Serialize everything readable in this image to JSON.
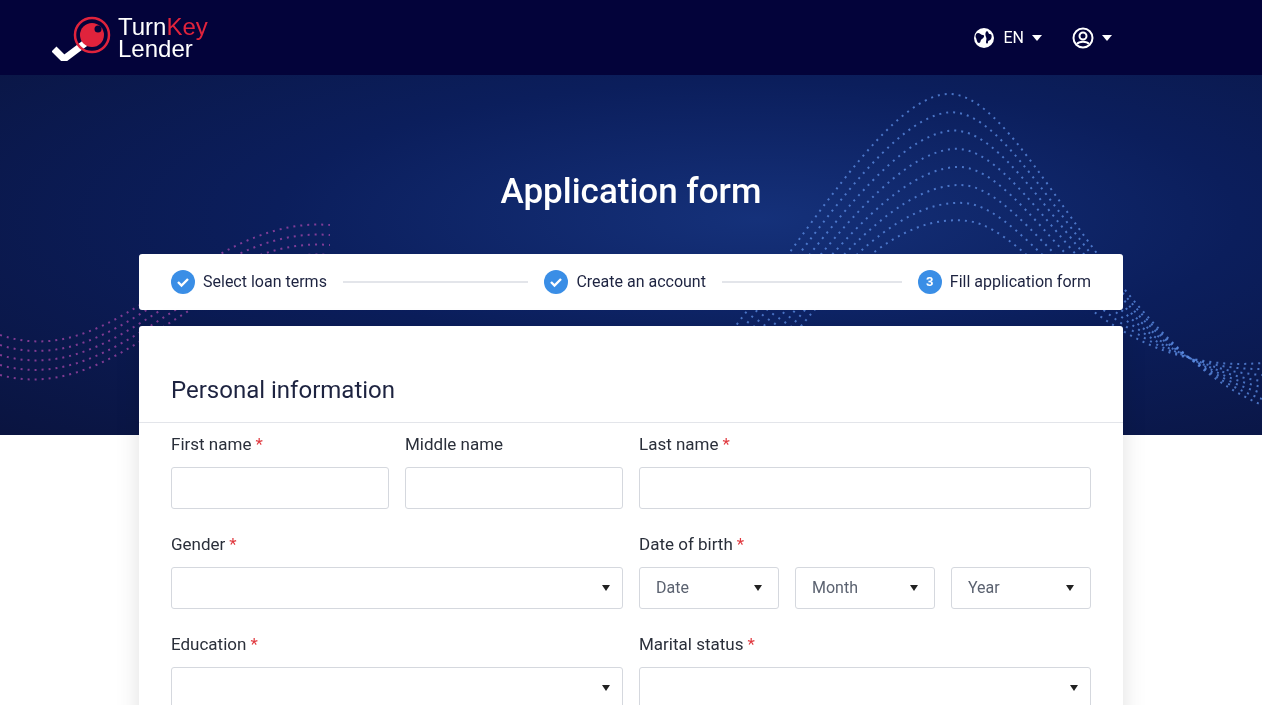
{
  "header": {
    "logo": {
      "part1": "Turn",
      "part2": "Key",
      "line2": "Lender"
    },
    "language": "EN"
  },
  "title": "Application form",
  "steps": [
    {
      "label": "Select loan terms",
      "done": true
    },
    {
      "label": "Create an account",
      "done": true
    },
    {
      "label": "Fill application form",
      "number": "3",
      "done": false
    }
  ],
  "section": {
    "title": "Personal information"
  },
  "required_mark": "*",
  "rows": [
    {
      "fields": [
        {
          "label": "First name",
          "required": true,
          "kind": "text"
        },
        {
          "label": "Middle name",
          "required": false,
          "kind": "text"
        },
        {
          "label": "Last name",
          "required": true,
          "kind": "text"
        }
      ]
    },
    {
      "fields": [
        {
          "label": "Gender",
          "required": true,
          "kind": "select"
        },
        {
          "label": "Date of birth",
          "required": true,
          "kind": "date",
          "parts": [
            "Date",
            "Month",
            "Year"
          ]
        }
      ]
    },
    {
      "fields": [
        {
          "label": "Education",
          "required": true,
          "kind": "select"
        },
        {
          "label": "Marital status",
          "required": true,
          "kind": "select"
        }
      ]
    }
  ]
}
